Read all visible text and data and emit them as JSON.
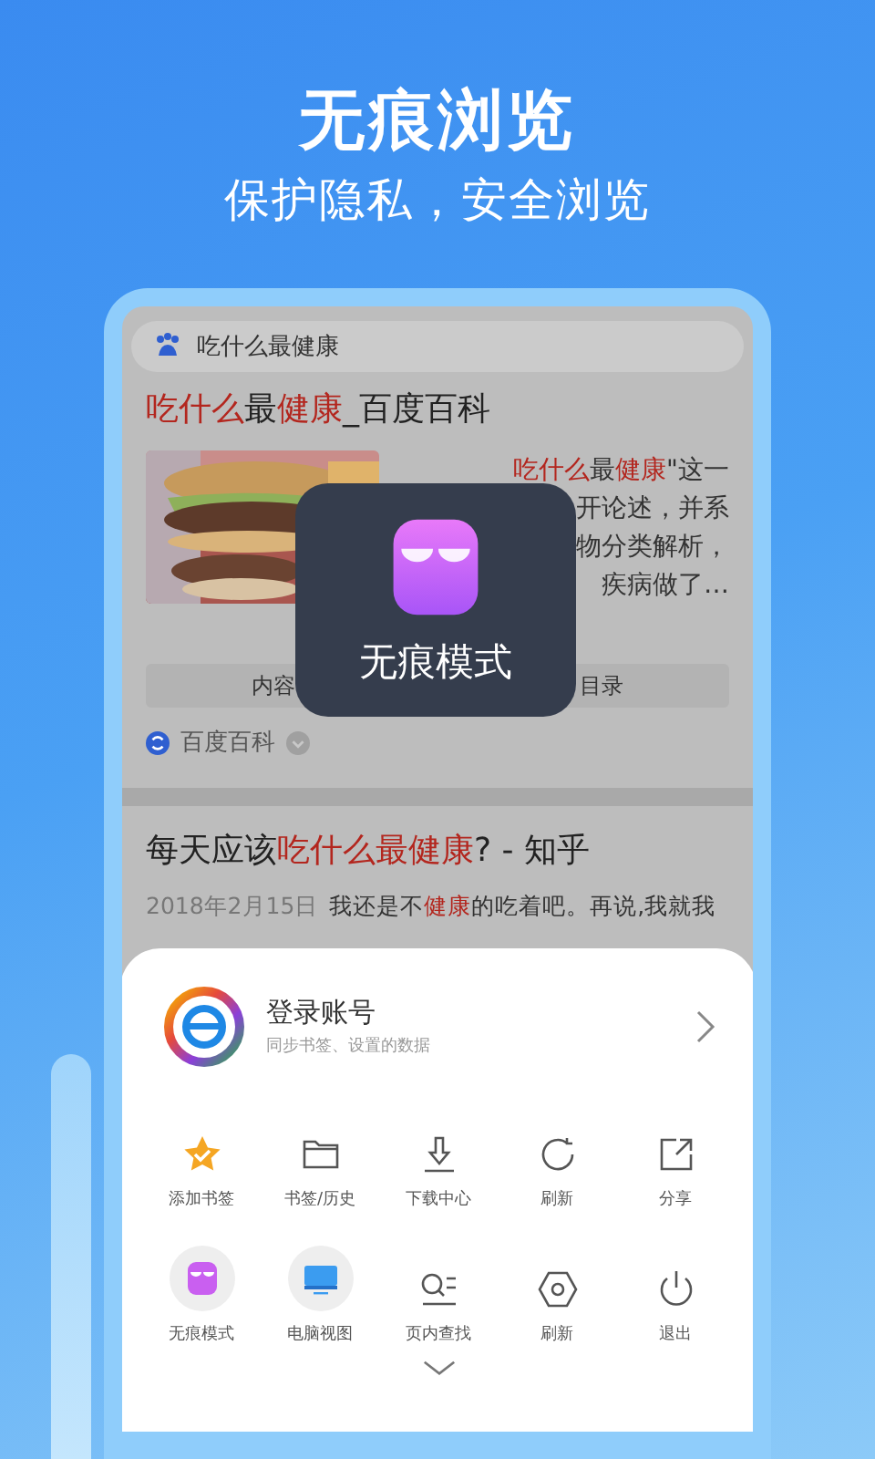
{
  "header": {
    "title": "无痕浏览",
    "subtitle": "保护隐私，安全浏览"
  },
  "search": {
    "value": "吃什么最健康"
  },
  "results": [
    {
      "kind": "encyclopedia",
      "title": [
        {
          "text": "吃什么",
          "highlight": true
        },
        {
          "text": "最",
          "highlight": false
        },
        {
          "text": "健康",
          "highlight": true
        },
        {
          "text": "_百度百科",
          "highlight": false
        }
      ],
      "snippet_lines": [
        [
          {
            "text": "吃什么",
            "highlight": true
          },
          {
            "text": "最",
            "highlight": false
          },
          {
            "text": "健康",
            "highlight": true
          },
          {
            "text": "\"这一",
            "highlight": false
          }
        ],
        [
          {
            "text": "开论述，并系",
            "highlight": false
          }
        ],
        [
          {
            "text": "物分类解析，",
            "highlight": false
          }
        ],
        [
          {
            "text": "疾病做了…",
            "highlight": false
          }
        ]
      ],
      "tabs": [
        "内容",
        "目录"
      ],
      "source": "百度百科"
    },
    {
      "kind": "qa",
      "title": [
        {
          "text": "每天应该",
          "highlight": false
        },
        {
          "text": "吃什么最健康",
          "highlight": true
        },
        {
          "text": "? - 知乎",
          "highlight": false
        }
      ],
      "date": "2018年2月15日",
      "snippet": [
        {
          "text": "我还是不",
          "highlight": false
        },
        {
          "text": "健康",
          "highlight": true
        },
        {
          "text": "的吃着吧。再说,我就我",
          "highlight": false
        }
      ]
    }
  ],
  "toast": {
    "label": "无痕模式"
  },
  "menu": {
    "account": {
      "title": "登录账号",
      "subtitle": "同步书签、设置的数据"
    },
    "items": [
      {
        "label": "添加书签"
      },
      {
        "label": "书签/历史"
      },
      {
        "label": "下载中心"
      },
      {
        "label": "刷新"
      },
      {
        "label": "分享"
      },
      {
        "label": "无痕模式"
      },
      {
        "label": "电脑视图"
      },
      {
        "label": "页内查找"
      },
      {
        "label": "刷新"
      },
      {
        "label": "退出"
      }
    ]
  }
}
